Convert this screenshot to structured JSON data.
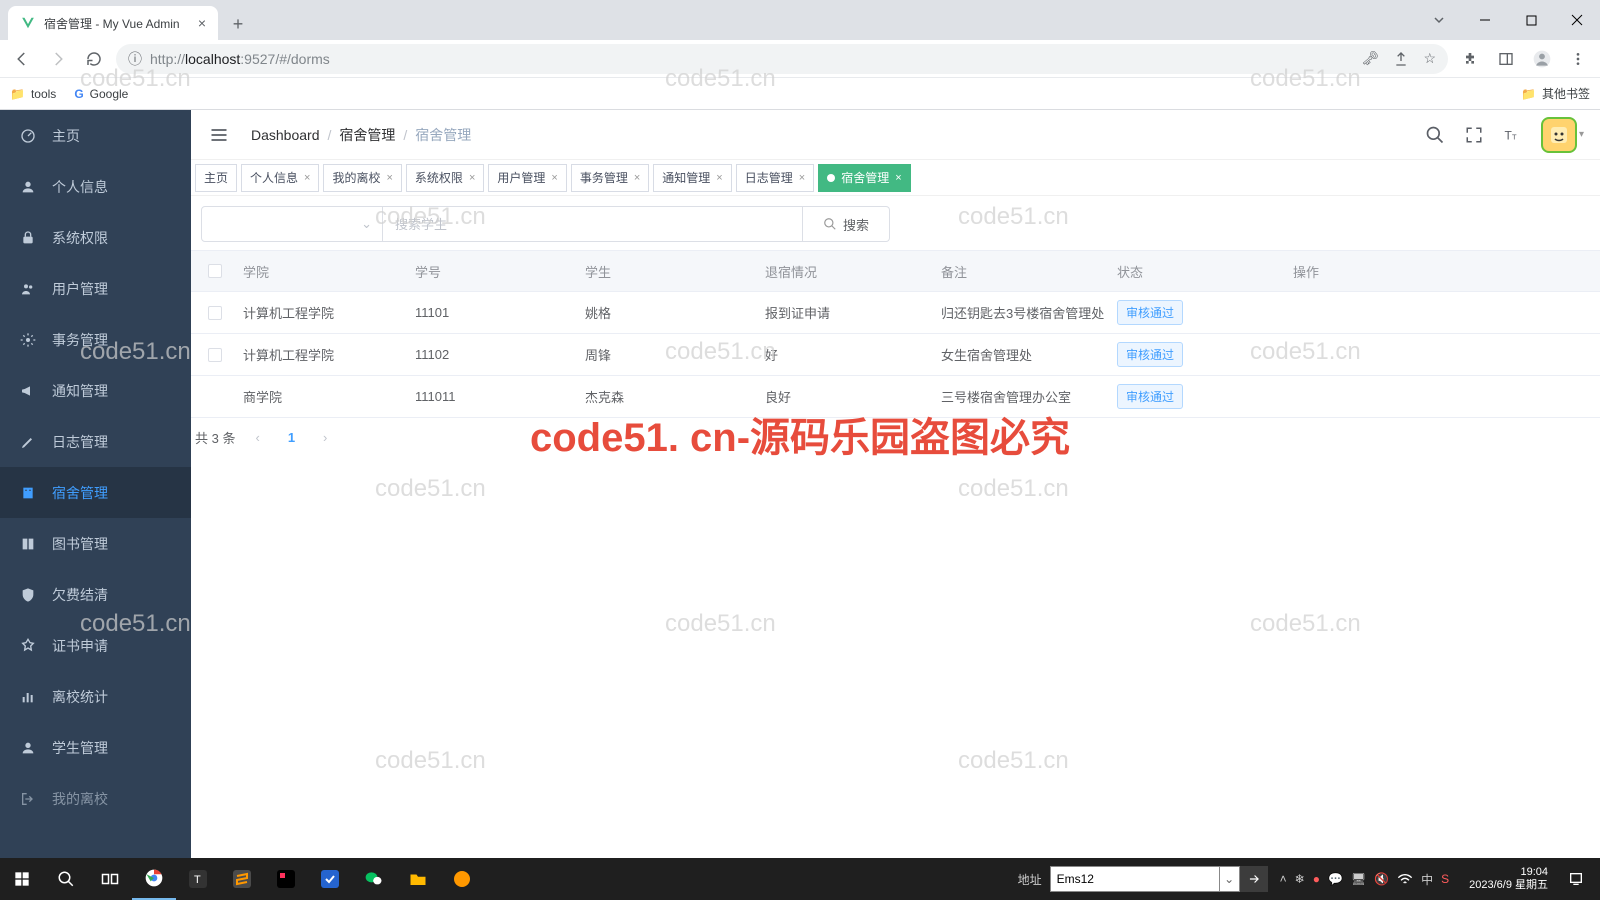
{
  "browser": {
    "tab_title": "宿舍管理 - My Vue Admin",
    "url_prefix": "http://",
    "url_host": "localhost",
    "url_rest": ":9527/#/dorms",
    "bookmark_tools": "tools",
    "bookmark_google": "Google",
    "bookmark_other": "其他书签"
  },
  "sidebar": {
    "items": [
      {
        "label": "主页"
      },
      {
        "label": "个人信息"
      },
      {
        "label": "系统权限"
      },
      {
        "label": "用户管理"
      },
      {
        "label": "事务管理"
      },
      {
        "label": "通知管理"
      },
      {
        "label": "日志管理"
      },
      {
        "label": "宿舍管理"
      },
      {
        "label": "图书管理"
      },
      {
        "label": "欠费结清"
      },
      {
        "label": "证书申请"
      },
      {
        "label": "离校统计"
      },
      {
        "label": "学生管理"
      },
      {
        "label": "我的离校"
      }
    ],
    "active_index": 7
  },
  "breadcrumb": {
    "items": [
      "Dashboard",
      "宿舍管理",
      "宿舍管理"
    ]
  },
  "tabs": {
    "items": [
      "主页",
      "个人信息",
      "我的离校",
      "系统权限",
      "用户管理",
      "事务管理",
      "通知管理",
      "日志管理",
      "宿舍管理"
    ],
    "active_index": 8
  },
  "search": {
    "placeholder": "搜索学生",
    "button": "搜索"
  },
  "table": {
    "headers": [
      "学院",
      "学号",
      "学生",
      "退宿情况",
      "备注",
      "状态",
      "操作"
    ],
    "rows": [
      {
        "college": "计算机工程学院",
        "id": "11101",
        "student": "姚格",
        "situation": "报到证申请",
        "note": "归还钥匙去3号楼宿舍管理处",
        "status": "审核通过"
      },
      {
        "college": "计算机工程学院",
        "id": "11102",
        "student": "周锋",
        "situation": "好",
        "note": "女生宿舍管理处",
        "status": "审核通过"
      },
      {
        "college": "商学院",
        "id": "111011",
        "student": "杰克森",
        "situation": "良好",
        "note": "三号楼宿舍管理办公室",
        "status": "审核通过"
      }
    ]
  },
  "pagination": {
    "total": "共 3 条",
    "page": "1"
  },
  "watermark_text": "code51.cn",
  "big_watermark": "code51. cn-源码乐园盗图必究",
  "taskbar": {
    "addr_label": "地址",
    "addr_value": "Ems12",
    "time": "19:04",
    "date": "2023/6/9 星期五"
  }
}
